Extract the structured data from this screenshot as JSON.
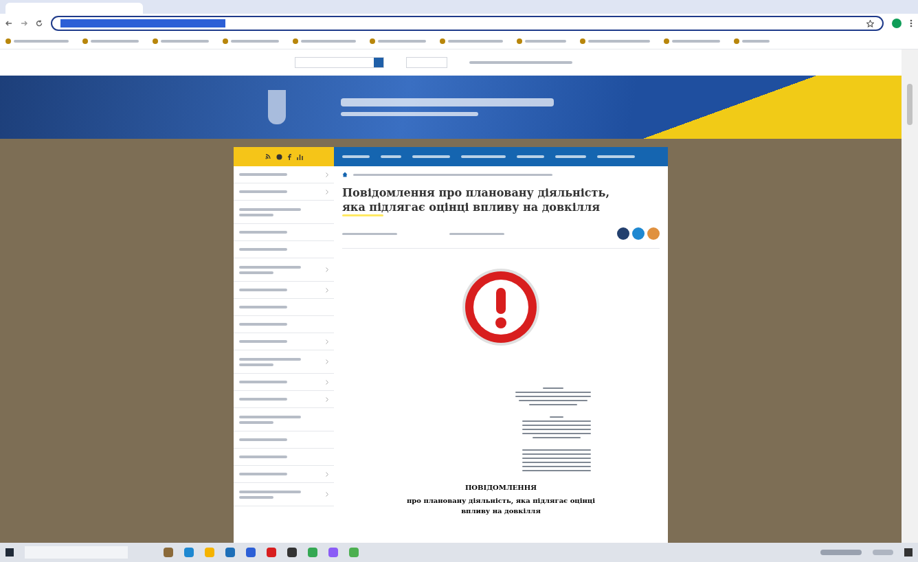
{
  "article": {
    "title": "Повідомлення про плановану діяльність, яка підлягає оцінці впливу на довкілля"
  },
  "document": {
    "heading": "ПОВІДОМЛЕННЯ",
    "subheading": "про плановану діяльність, яка підлягає оцінці впливу на довкілля"
  },
  "sidebar": {
    "items": [
      {
        "kind": "single",
        "submenu": true
      },
      {
        "kind": "single",
        "submenu": true
      },
      {
        "kind": "double",
        "submenu": false
      },
      {
        "kind": "single",
        "submenu": false
      },
      {
        "kind": "single",
        "submenu": false
      },
      {
        "kind": "double",
        "submenu": true
      },
      {
        "kind": "single",
        "submenu": true
      },
      {
        "kind": "single",
        "submenu": false
      },
      {
        "kind": "single",
        "submenu": false
      },
      {
        "kind": "single",
        "submenu": true
      },
      {
        "kind": "double",
        "submenu": true
      },
      {
        "kind": "single",
        "submenu": true
      },
      {
        "kind": "single",
        "submenu": true
      },
      {
        "kind": "double",
        "submenu": false
      },
      {
        "kind": "single",
        "submenu": false
      },
      {
        "kind": "single",
        "submenu": false
      },
      {
        "kind": "single",
        "submenu": true
      },
      {
        "kind": "double",
        "submenu": true
      }
    ]
  }
}
